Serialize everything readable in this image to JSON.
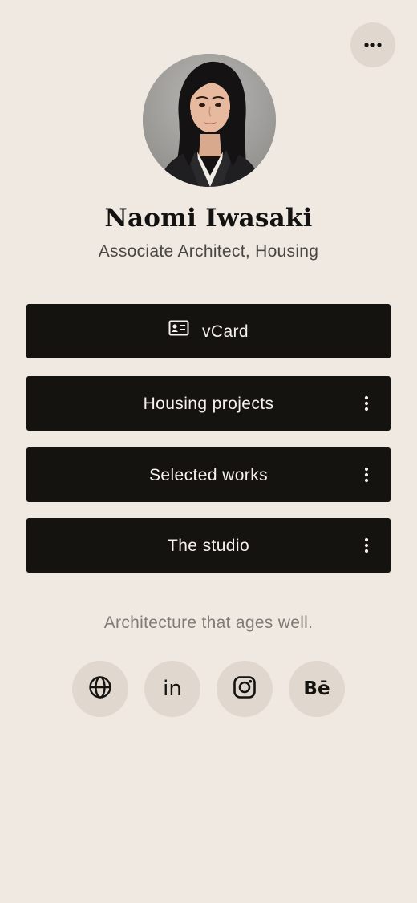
{
  "header": {
    "menu_icon": "more-horizontal-icon"
  },
  "profile": {
    "name": "Naomi Iwasaki",
    "role": "Associate Architect, Housing",
    "avatar": "profile-photo"
  },
  "links": [
    {
      "label": "vCard",
      "icon": "id-card-icon"
    },
    {
      "label": "Housing projects",
      "icon": "more-vertical-icon"
    },
    {
      "label": "Selected works",
      "icon": "more-vertical-icon"
    },
    {
      "label": "The studio",
      "icon": "more-vertical-icon"
    }
  ],
  "tagline": "Architecture that ages well.",
  "socials": [
    {
      "icon": "globe-icon",
      "text": ""
    },
    {
      "icon": "linkedin-icon",
      "text": "in"
    },
    {
      "icon": "instagram-icon",
      "text": ""
    },
    {
      "icon": "behance-icon",
      "text": "Bē"
    }
  ],
  "colors": {
    "background": "#efe9e2",
    "button": "#15130f",
    "button_text": "#f5f1ec",
    "chip": "#e0d8ce",
    "muted_text": "#807b74"
  }
}
